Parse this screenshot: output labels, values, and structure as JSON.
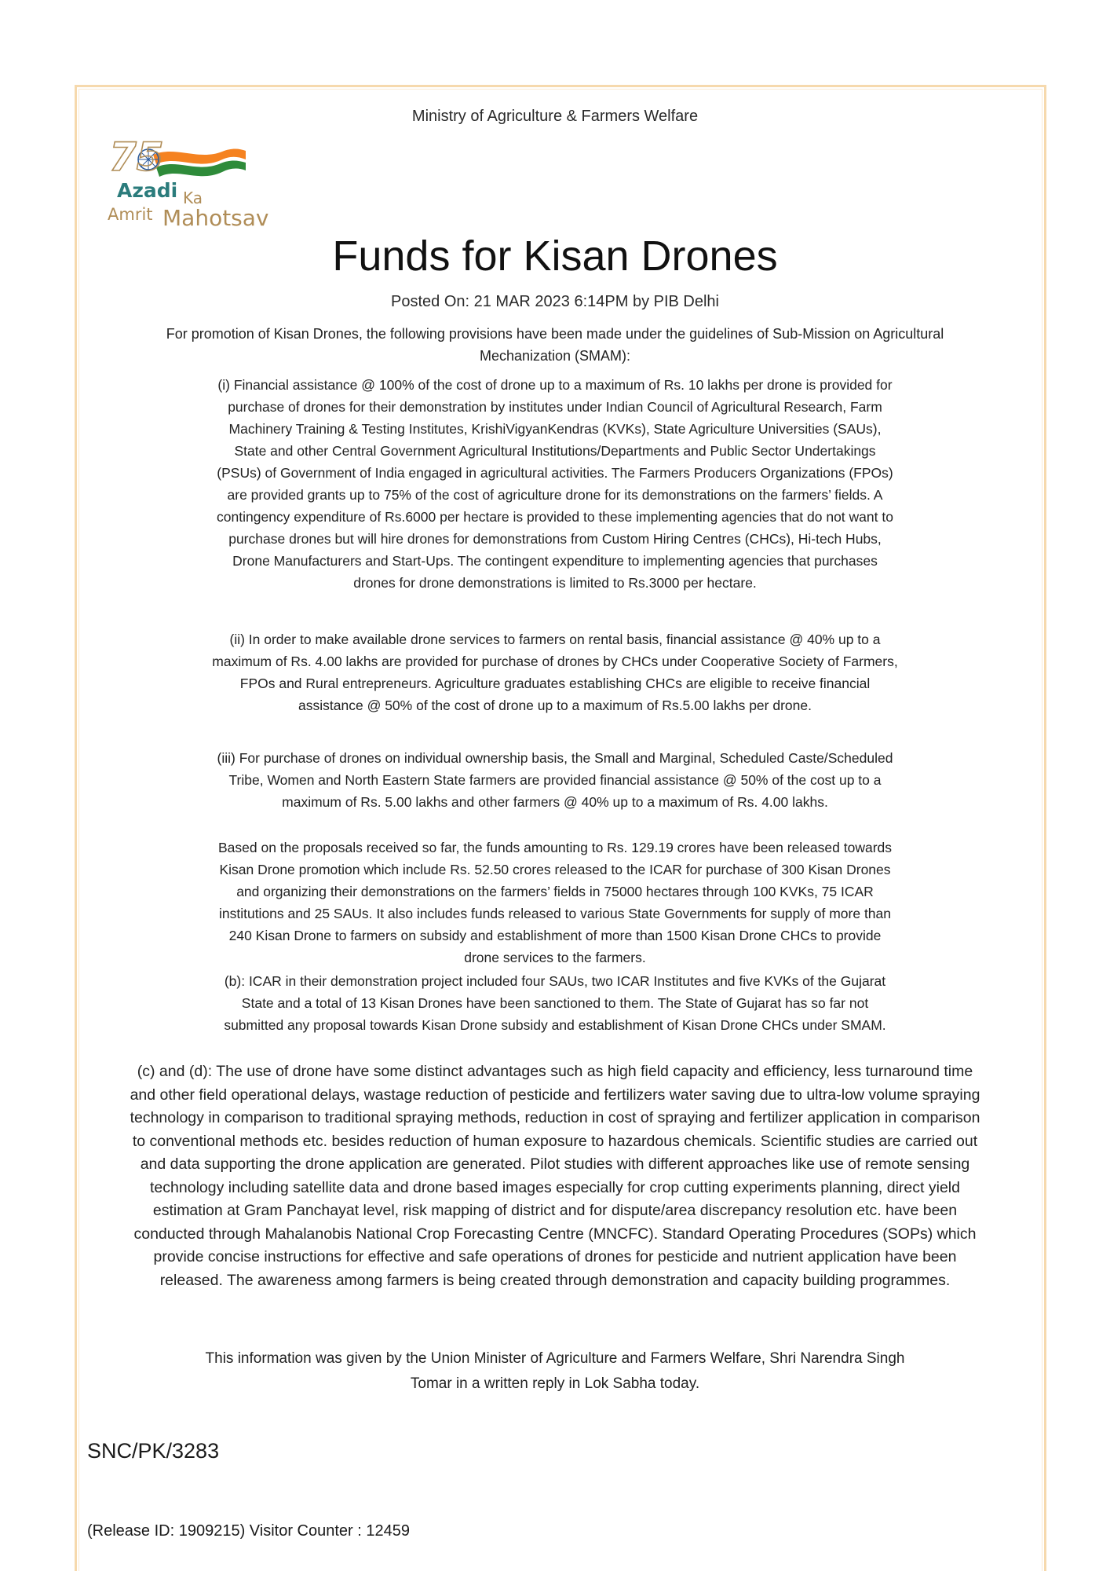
{
  "header": {
    "ministry": "Ministry of Agriculture & Farmers Welfare"
  },
  "logo": {
    "number": "75",
    "line1": "Azadi",
    "line1b": "Ka",
    "line2a": "Amrit",
    "line2b": "Mahotsav",
    "colors": {
      "gold": "#b08d57",
      "saffron": "#f58220",
      "green": "#2e8b3a",
      "teal": "#2b7c7c"
    }
  },
  "article": {
    "title": "Funds for Kisan Drones",
    "posted": "Posted On: 21 MAR 2023 6:14PM by PIB Delhi",
    "intro": "For promotion of Kisan Drones, the following provisions have been made under the guidelines of Sub-Mission on Agricultural Mechanization (SMAM):",
    "para_i": "(i) Financial assistance @ 100% of the cost of drone up to a maximum of Rs. 10 lakhs per drone is provided for purchase of drones for their demonstration by institutes under Indian Council of Agricultural Research, Farm Machinery Training & Testing Institutes, KrishiVigyanKendras (KVKs), State Agriculture Universities (SAUs), State and other Central Government Agricultural Institutions/Departments and Public Sector Undertakings (PSUs) of Government of India engaged in agricultural activities. The Farmers Producers Organizations (FPOs) are provided grants up to 75% of the cost of agriculture drone for its demonstrations on the farmers’ fields. A contingency expenditure of Rs.6000 per hectare is provided to these implementing agencies that do not want to purchase drones but will hire drones for demonstrations from Custom Hiring Centres (CHCs), Hi-tech Hubs, Drone Manufacturers and Start-Ups. The contingent expenditure to implementing agencies that purchases drones for drone demonstrations is limited to Rs.3000 per hectare.",
    "para_ii": "(ii) In order to make available drone services to farmers on rental basis, financial assistance @ 40% up to a maximum of Rs. 4.00 lakhs are provided for purchase of drones by CHCs under Cooperative Society of Farmers, FPOs and Rural entrepreneurs. Agriculture graduates establishing CHCs are eligible to receive financial assistance @ 50% of the cost of drone up to a maximum of Rs.5.00 lakhs per drone.",
    "para_iii": "(iii) For purchase of drones on individual ownership basis, the Small and Marginal, Scheduled Caste/Scheduled Tribe, Women and North Eastern State farmers are provided financial assistance @ 50% of the cost up to a maximum of Rs. 5.00 lakhs and other farmers @ 40% up to a maximum of Rs. 4.00 lakhs.",
    "para_based": "Based on the proposals received so far, the funds amounting to Rs. 129.19 crores have been released towards Kisan Drone promotion which include Rs. 52.50 crores released to the ICAR for purchase of 300 Kisan Drones and organizing their demonstrations on the farmers’ fields in 75000 hectares through 100 KVKs, 75 ICAR institutions and 25 SAUs. It also includes funds released to various State Governments for supply of more than 240 Kisan Drone to farmers on subsidy and establishment of more than 1500 Kisan Drone CHCs to provide drone services to the farmers.",
    "para_b": "(b): ICAR in their demonstration project included four SAUs, two ICAR Institutes and five KVKs of the Gujarat State and a total of 13 Kisan Drones have been sanctioned to them. The State of Gujarat has so far not submitted any proposal towards Kisan Drone subsidy and establishment of Kisan Drone CHCs under SMAM.",
    "para_cd": "(c) and (d): The use of drone have some distinct advantages such as high field capacity and efficiency, less turnaround time and other field operational delays, wastage reduction of pesticide and fertilizers water saving due to ultra-low volume spraying technology in comparison to traditional spraying methods, reduction in cost of spraying and fertilizer application in comparison to conventional methods etc. besides reduction of human exposure to hazardous chemicals. Scientific studies are carried out and data supporting the drone application are generated. Pilot studies with different approaches like use of remote sensing technology including satellite data and drone based images especially for crop cutting experiments planning, direct yield estimation at Gram Panchayat level, risk mapping of district and for dispute/area discrepancy resolution etc. have been conducted through Mahalanobis National Crop Forecasting Centre (MNCFC). Standard Operating Procedures (SOPs) which provide concise instructions for effective and safe operations of drones for pesticide and nutrient application have been released. The awareness among farmers is being created through demonstration and capacity building programmes.",
    "para_info": "This information was given by the Union Minister of Agriculture and Farmers Welfare, Shri Narendra Singh Tomar in a written reply in Lok Sabha today."
  },
  "footer": {
    "reference": "SNC/PK/3283",
    "release": "(Release ID: 1909215) Visitor Counter : 12459"
  }
}
